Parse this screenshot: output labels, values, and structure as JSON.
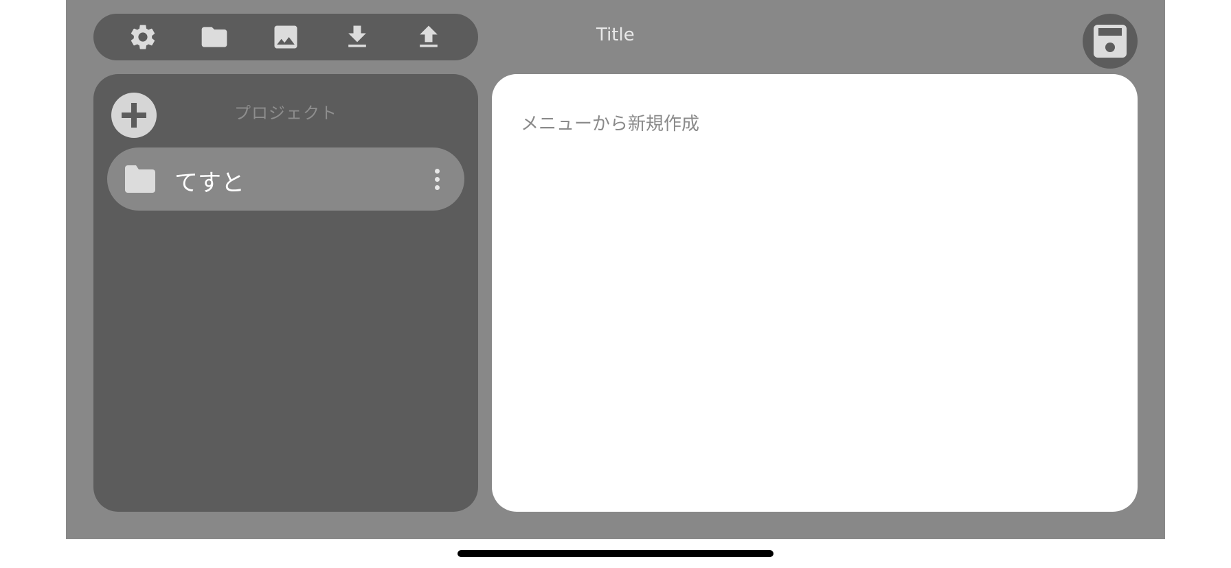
{
  "header": {
    "title": "Title"
  },
  "toolbar": {
    "buttons": [
      {
        "icon": "gear-icon"
      },
      {
        "icon": "folder-icon"
      },
      {
        "icon": "image-icon"
      },
      {
        "icon": "download-icon"
      },
      {
        "icon": "upload-icon"
      }
    ]
  },
  "save": {
    "icon": "floppy-disk-icon"
  },
  "sidebar": {
    "title": "プロジェクト",
    "add_icon": "plus-icon",
    "items": [
      {
        "label": "てすと",
        "icon": "folder-icon",
        "menu_icon": "more-vertical-icon"
      }
    ]
  },
  "main": {
    "placeholder": "メニューから新規作成"
  },
  "colors": {
    "background": "#888888",
    "panel": "#5c5c5c",
    "icon": "#dcdcdc",
    "content": "#ffffff"
  }
}
